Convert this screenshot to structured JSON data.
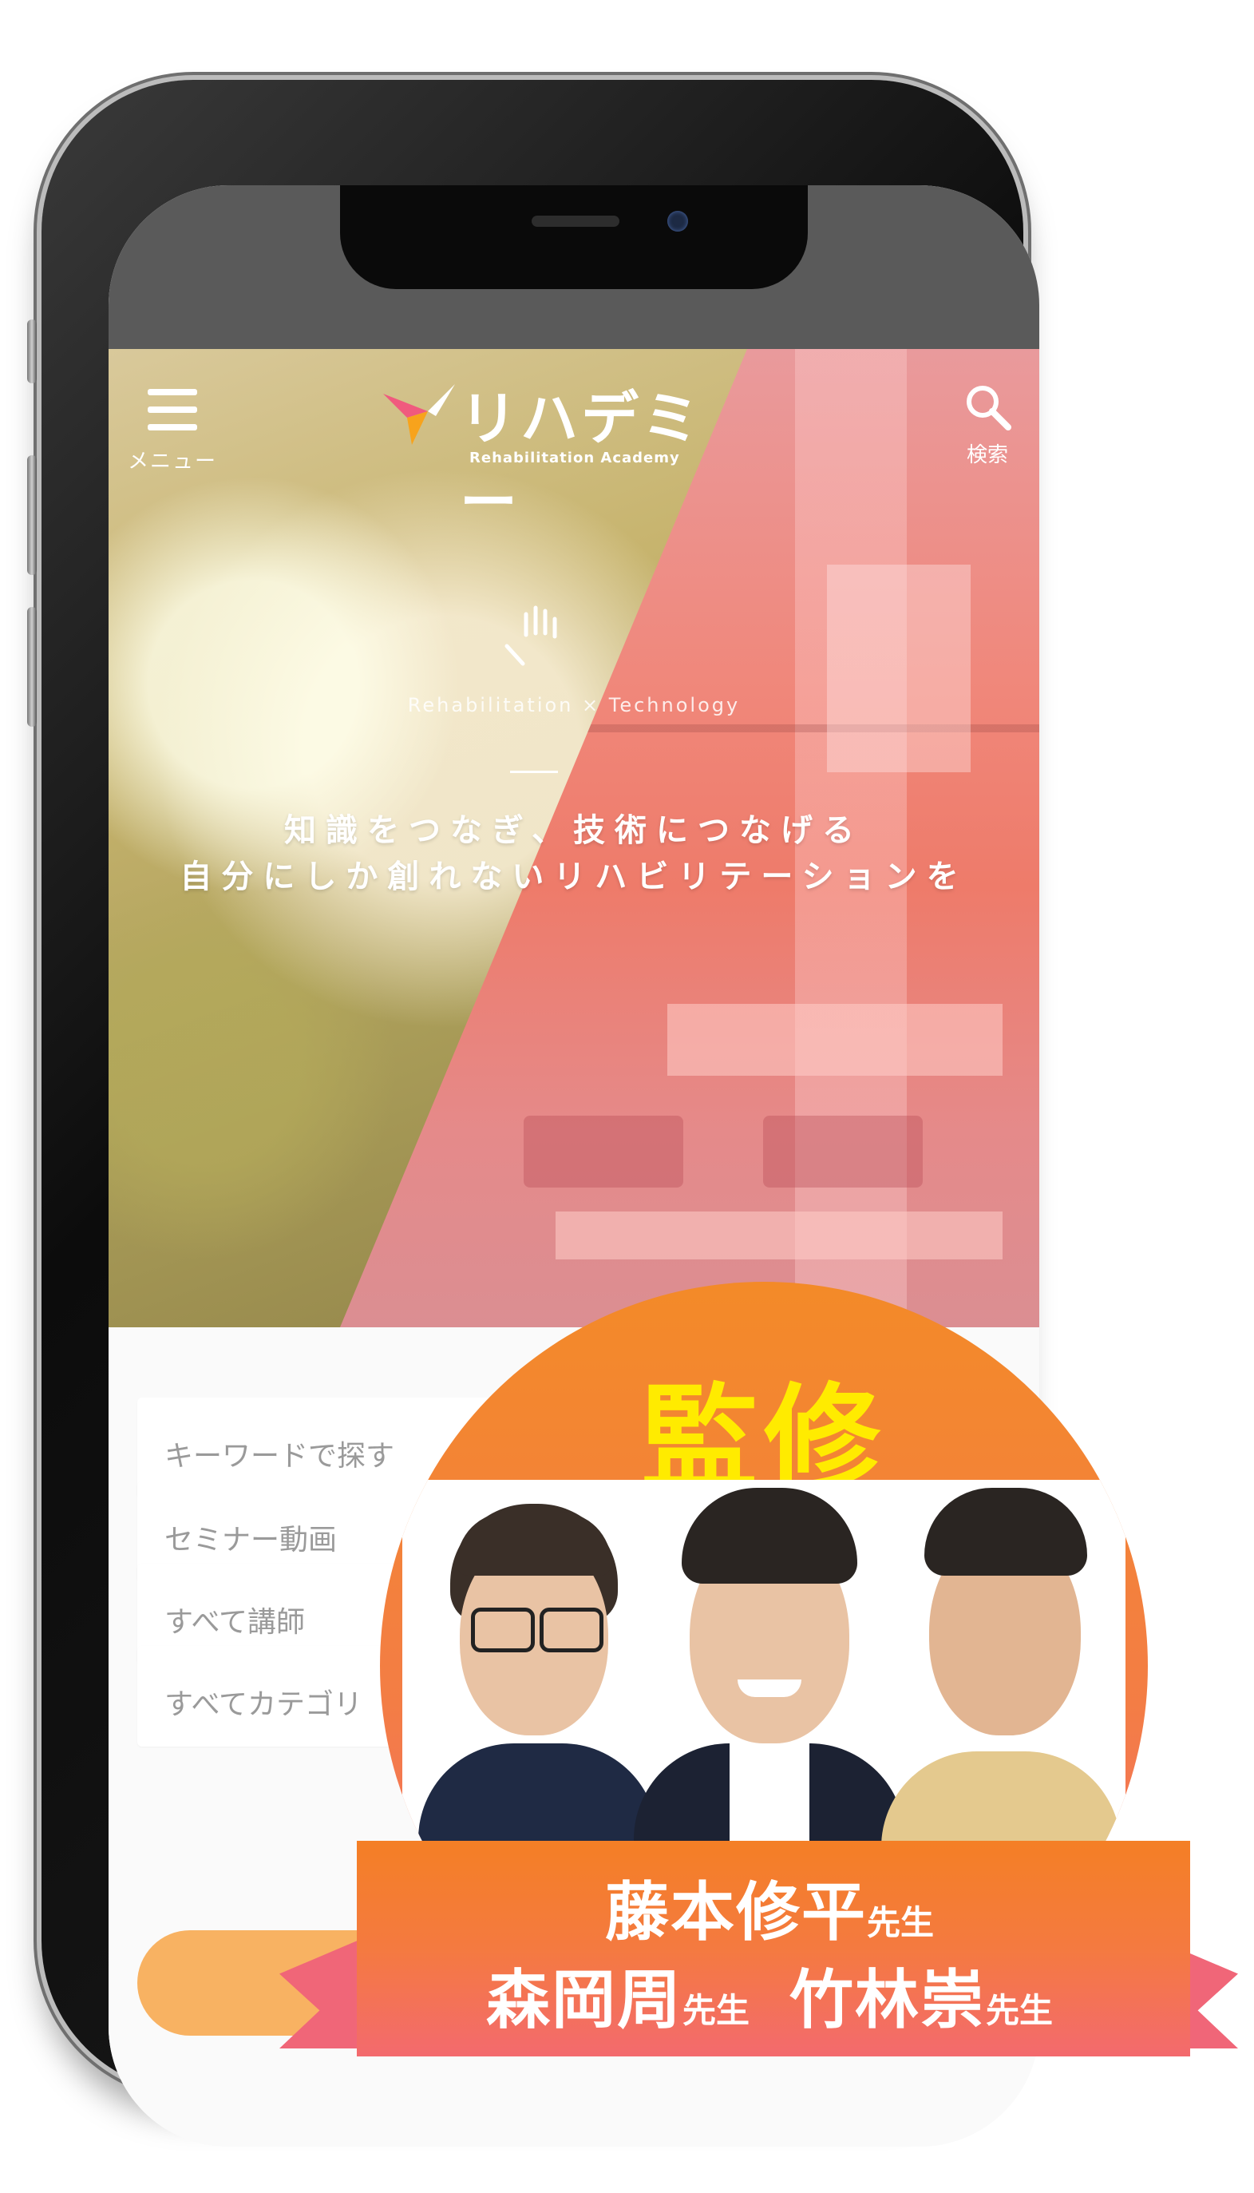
{
  "header": {
    "menu_label": "メニュー",
    "search_label": "検索",
    "logo_text": "リハデミー",
    "logo_subtext": "Rehabilitation Academy"
  },
  "hero": {
    "tagline_en": "Rehabilitation × Technology",
    "headline_line1": "知識をつなぎ、技術につなげる",
    "headline_line2": "自分にしか創れないリハビリテーションを"
  },
  "search_form": {
    "keyword_placeholder": "キーワードで探す",
    "type_select": "セミナー動画",
    "instructor_select": "すべて講師",
    "category_select": "すべてカテゴリ",
    "submit_color": "#f8b262"
  },
  "badge": {
    "title": "監修",
    "title_color": "#ffeb00",
    "supervisors": [
      {
        "name": "藤本修平",
        "suffix": "先生"
      },
      {
        "name": "森岡周",
        "suffix": "先生"
      },
      {
        "name": "竹林崇",
        "suffix": "先生"
      }
    ]
  },
  "colors": {
    "accent_orange": "#f47f25",
    "accent_pink": "#f36a6e"
  }
}
